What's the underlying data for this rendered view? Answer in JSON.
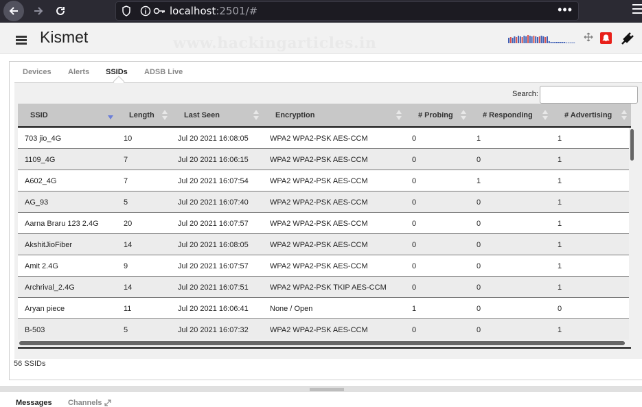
{
  "browser": {
    "url_host": "localhost",
    "url_rest": ":2501/#",
    "menu_dots": "•••"
  },
  "app": {
    "title": "Kismet",
    "watermark": "www.hackingarticles.in"
  },
  "tabs": [
    "Devices",
    "Alerts",
    "SSIDs",
    "ADSB Live"
  ],
  "active_tab": "SSIDs",
  "search": {
    "label": "Search:",
    "value": ""
  },
  "table": {
    "columns": [
      "SSID",
      "Length",
      "Last Seen",
      "Encryption",
      "# Probing",
      "# Responding",
      "# Advertising"
    ],
    "sorted_column": "SSID",
    "rows": [
      [
        "703 jio_4G",
        "10",
        "Jul 20 2021 16:08:05",
        "WPA2 WPA2-PSK AES-CCM",
        "0",
        "1",
        "1"
      ],
      [
        "1109_4G",
        "7",
        "Jul 20 2021 16:06:15",
        "WPA2 WPA2-PSK AES-CCM",
        "0",
        "0",
        "1"
      ],
      [
        "A602_4G",
        "7",
        "Jul 20 2021 16:07:54",
        "WPA2 WPA2-PSK AES-CCM",
        "0",
        "1",
        "1"
      ],
      [
        "AG_93",
        "5",
        "Jul 20 2021 16:07:40",
        "WPA2 WPA2-PSK AES-CCM",
        "0",
        "0",
        "1"
      ],
      [
        "Aarna Braru 123 2.4G",
        "20",
        "Jul 20 2021 16:07:57",
        "WPA2 WPA2-PSK AES-CCM",
        "0",
        "0",
        "1"
      ],
      [
        "AkshitJioFiber",
        "14",
        "Jul 20 2021 16:08:05",
        "WPA2 WPA2-PSK AES-CCM",
        "0",
        "0",
        "1"
      ],
      [
        "Amit 2.4G",
        "9",
        "Jul 20 2021 16:07:57",
        "WPA2 WPA2-PSK AES-CCM",
        "0",
        "0",
        "1"
      ],
      [
        "Archrival_2.4G",
        "14",
        "Jul 20 2021 16:07:51",
        "WPA2 WPA2-PSK TKIP AES-CCM",
        "0",
        "0",
        "1"
      ],
      [
        "Aryan piece",
        "11",
        "Jul 20 2021 16:06:41",
        "None / Open",
        "1",
        "0",
        "0"
      ],
      [
        "B-503",
        "5",
        "Jul 20 2021 16:07:32",
        "WPA2 WPA2-PSK AES-CCM",
        "0",
        "0",
        "1"
      ]
    ]
  },
  "summary": "56 SSIDs",
  "bottom_tabs": [
    "Messages",
    "Channels"
  ],
  "colors": {
    "sparkline_red": "#d9534f",
    "sparkline_blue": "#3f5fb5",
    "alert_red": "#e8201a",
    "sort_indicator": "#6c7fd8"
  }
}
